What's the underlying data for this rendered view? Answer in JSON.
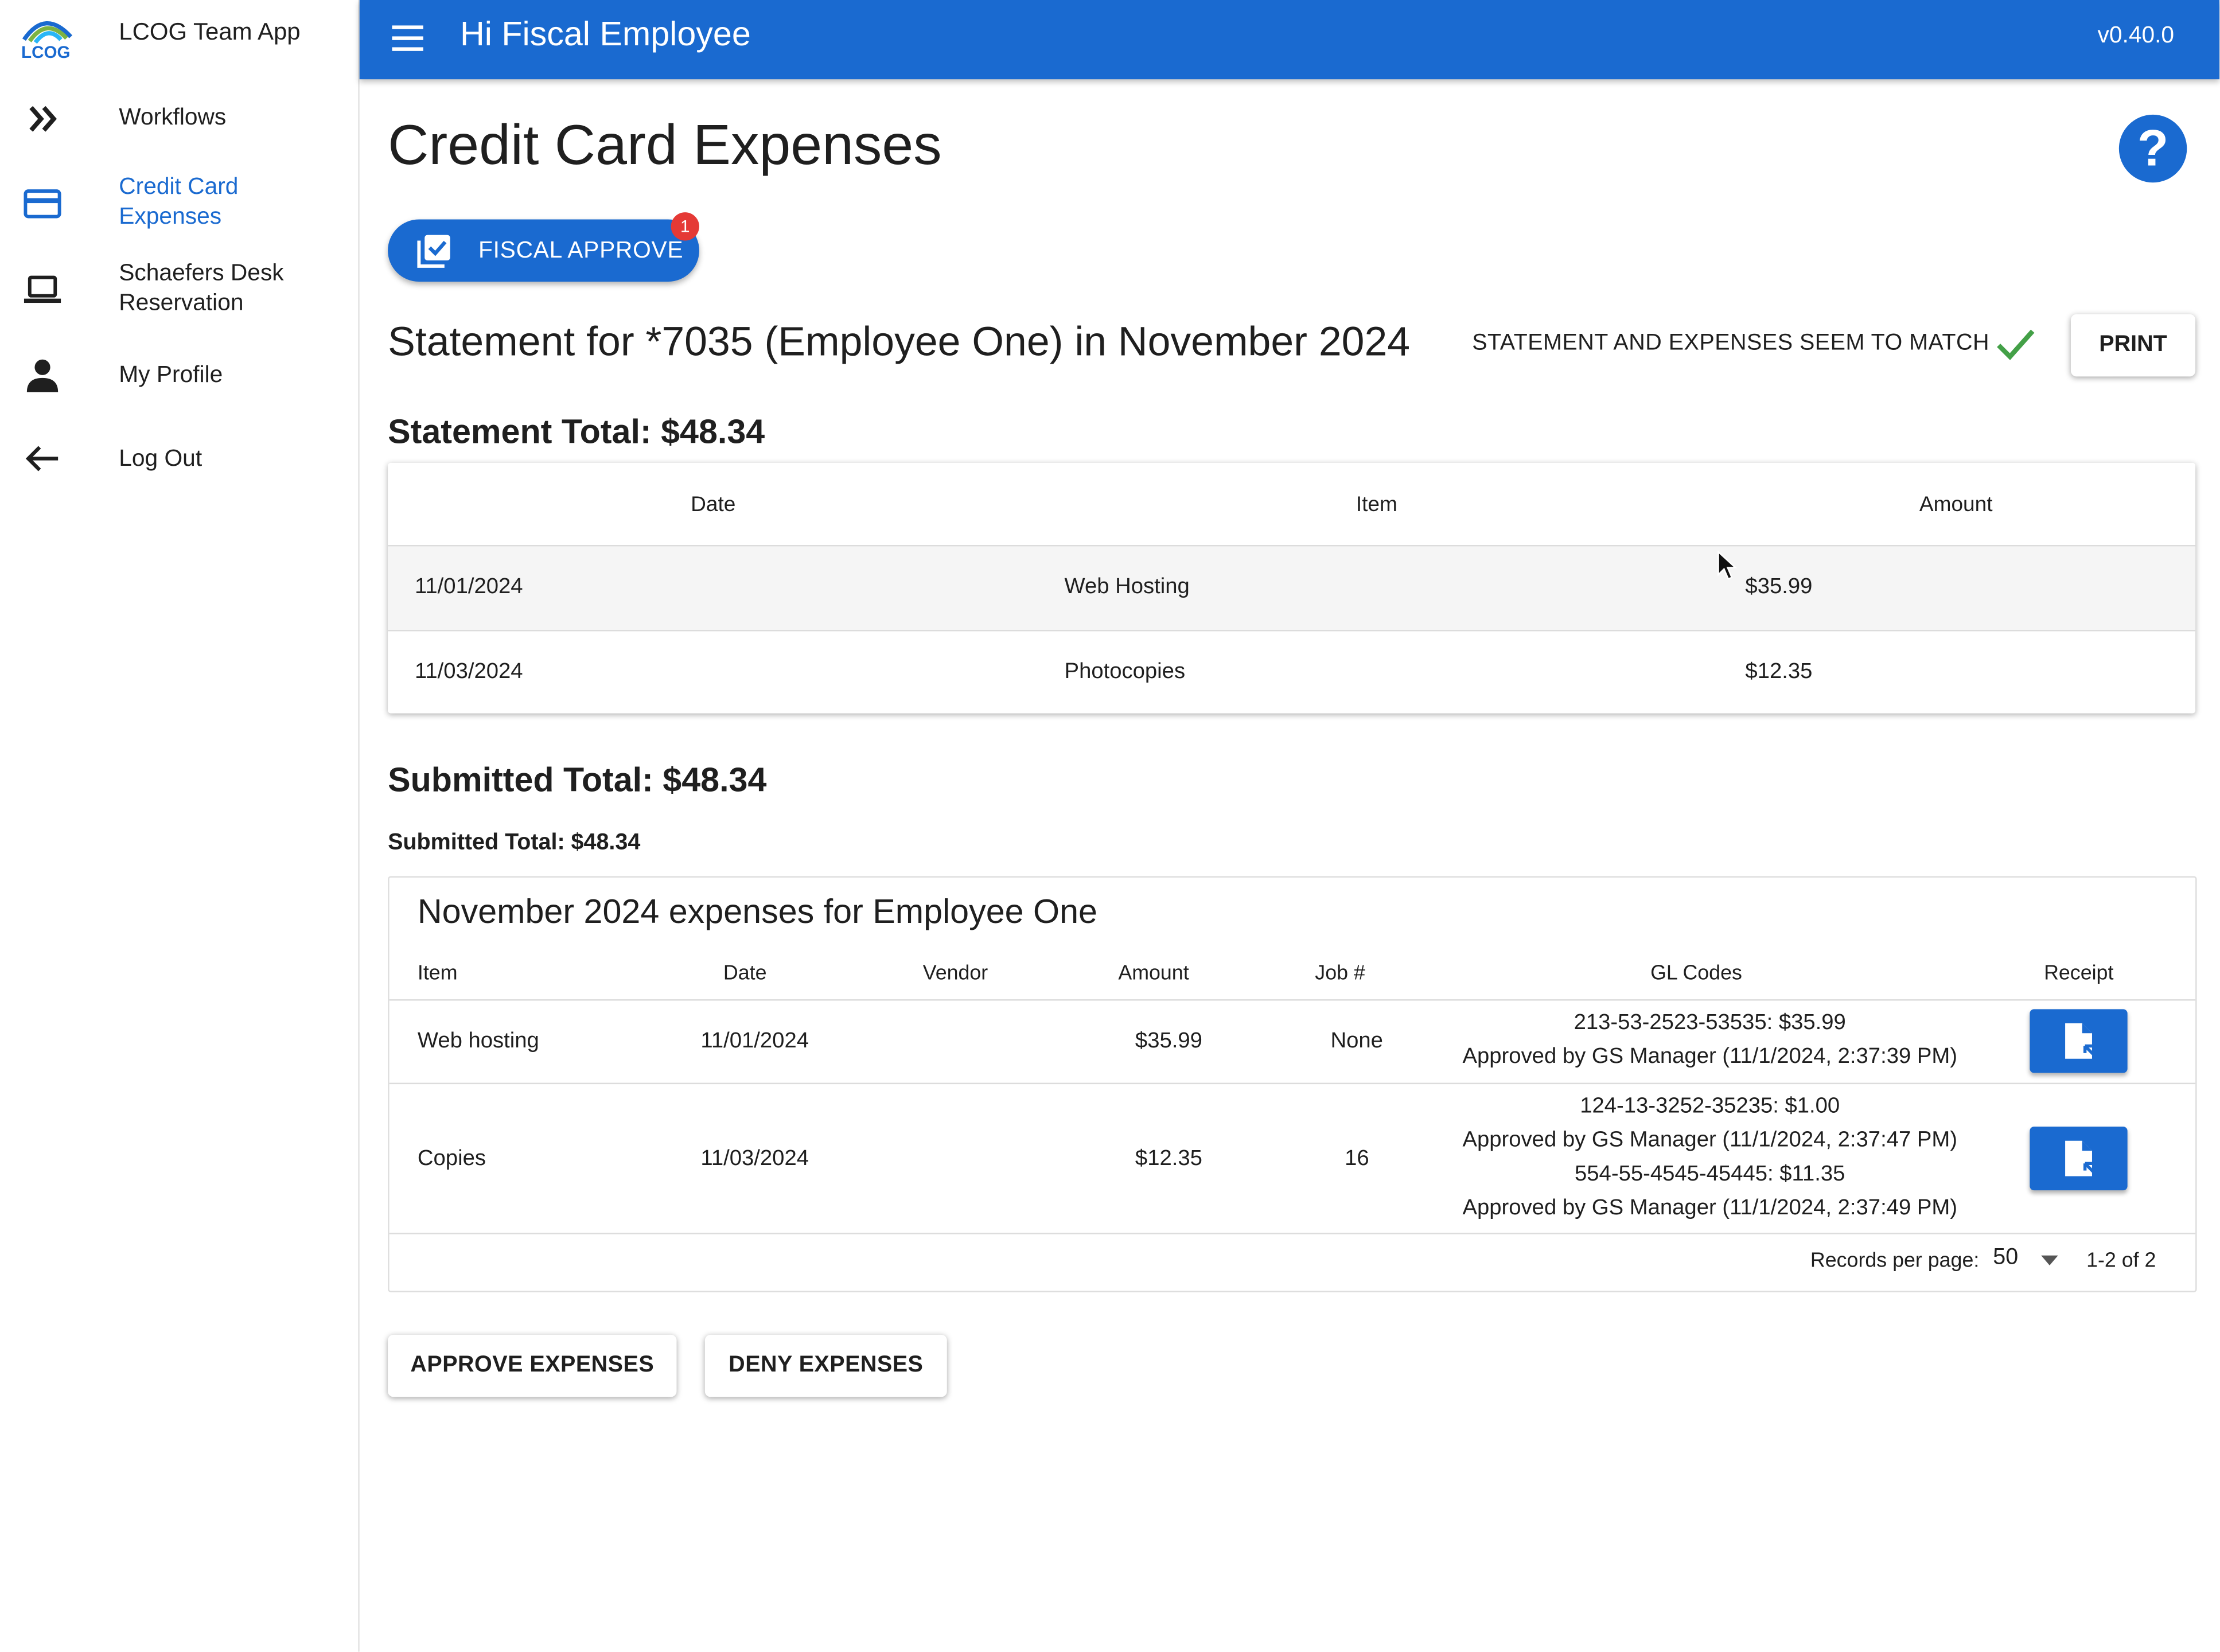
{
  "sidebar": {
    "app_title": "LCOG Team App",
    "logo_text": "LCOG",
    "items": [
      {
        "label": "Workflows",
        "icon": "double-chevron-right-icon"
      },
      {
        "label": "Credit Card Expenses",
        "icon": "credit-card-icon",
        "active": true
      },
      {
        "label": "Schaefers Desk Reservation",
        "icon": "laptop-icon"
      },
      {
        "label": "My Profile",
        "icon": "person-icon"
      },
      {
        "label": "Log Out",
        "icon": "arrow-left-icon"
      }
    ]
  },
  "topbar": {
    "greeting": "Hi Fiscal Employee",
    "version": "v0.40.0"
  },
  "colors": {
    "primary": "#1a6ad0",
    "badge": "#e53935",
    "success": "#43a047"
  },
  "page": {
    "title": "Credit Card Expenses",
    "help_label": "?",
    "fiscal_approve": {
      "label": "FISCAL APPROVE",
      "badge_count": "1"
    },
    "statement_heading": "Statement for *7035 (Employee One) in November 2024",
    "match_status": "STATEMENT AND EXPENSES SEEM TO MATCH",
    "print_label": "PRINT",
    "statement_total": "Statement Total: $48.34",
    "statement_table": {
      "headers": [
        "Date",
        "Item",
        "Amount"
      ],
      "rows": [
        {
          "date": "11/01/2024",
          "item": "Web Hosting",
          "amount": "$35.99"
        },
        {
          "date": "11/03/2024",
          "item": "Photocopies",
          "amount": "$12.35"
        }
      ]
    },
    "submitted_total_big": "Submitted Total: $48.34",
    "submitted_total_small": "Submitted Total: $48.34",
    "expenses": {
      "title": "November 2024 expenses for Employee One",
      "headers": [
        "Item",
        "Date",
        "Vendor",
        "Amount",
        "Job #",
        "GL Codes",
        "Receipt"
      ],
      "rows": [
        {
          "item": "Web hosting",
          "date": "11/01/2024",
          "vendor": "",
          "amount": "$35.99",
          "job": "None",
          "gl_lines": [
            "213-53-2523-53535: $35.99",
            "Approved by GS Manager (11/1/2024, 2:37:39 PM)"
          ]
        },
        {
          "item": "Copies",
          "date": "11/03/2024",
          "vendor": "",
          "amount": "$12.35",
          "job": "16",
          "gl_lines": [
            "124-13-3252-35235: $1.00",
            "Approved by GS Manager (11/1/2024, 2:37:47 PM)",
            "554-55-4545-45445: $11.35",
            "Approved by GS Manager (11/1/2024, 2:37:49 PM)"
          ]
        }
      ],
      "footer": {
        "records_label": "Records per page:",
        "per_page": "50",
        "range": "1-2 of 2"
      }
    },
    "approve_label": "APPROVE EXPENSES",
    "deny_label": "DENY EXPENSES"
  }
}
